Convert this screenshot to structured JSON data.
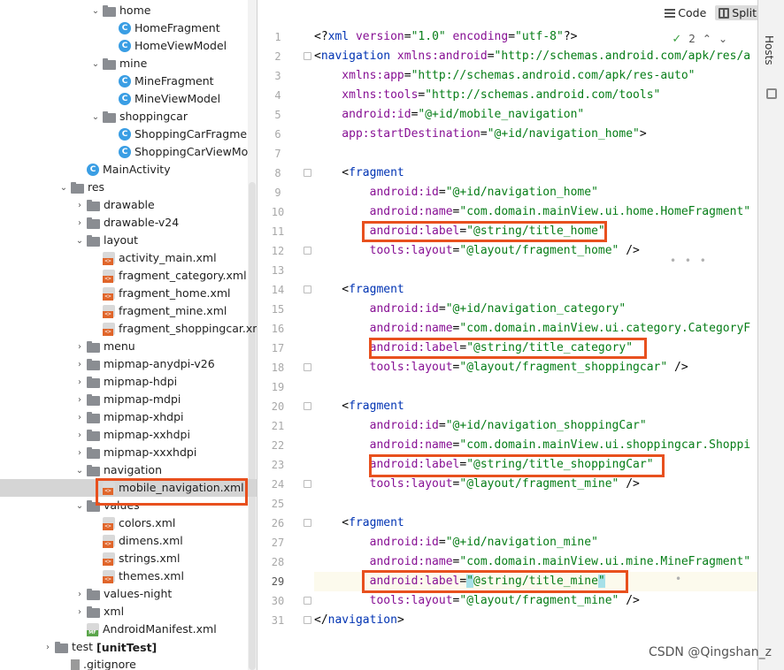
{
  "project_tree": {
    "rows": [
      {
        "label": "home",
        "kind": "folder",
        "depth": 3,
        "expanded": true
      },
      {
        "label": "HomeFragment",
        "kind": "class",
        "depth": 4
      },
      {
        "label": "HomeViewModel",
        "kind": "class",
        "depth": 4
      },
      {
        "label": "mine",
        "kind": "folder",
        "depth": 3,
        "expanded": true
      },
      {
        "label": "MineFragment",
        "kind": "class",
        "depth": 4
      },
      {
        "label": "MineViewModel",
        "kind": "class",
        "depth": 4
      },
      {
        "label": "shoppingcar",
        "kind": "folder",
        "depth": 3,
        "expanded": true
      },
      {
        "label": "ShoppingCarFragme",
        "kind": "class",
        "depth": 4
      },
      {
        "label": "ShoppingCarViewMo",
        "kind": "class",
        "depth": 4
      },
      {
        "label": "MainActivity",
        "kind": "class",
        "depth": 2
      },
      {
        "label": "res",
        "kind": "folder",
        "depth": 1,
        "expanded": true
      },
      {
        "label": "drawable",
        "kind": "folder",
        "depth": 2,
        "expanded": false
      },
      {
        "label": "drawable-v24",
        "kind": "folder",
        "depth": 2,
        "expanded": false
      },
      {
        "label": "layout",
        "kind": "folder",
        "depth": 2,
        "expanded": true
      },
      {
        "label": "activity_main.xml",
        "kind": "xml",
        "depth": 3
      },
      {
        "label": "fragment_category.xml",
        "kind": "xml",
        "depth": 3
      },
      {
        "label": "fragment_home.xml",
        "kind": "xml",
        "depth": 3
      },
      {
        "label": "fragment_mine.xml",
        "kind": "xml",
        "depth": 3
      },
      {
        "label": "fragment_shoppingcar.xml",
        "kind": "xml",
        "depth": 3
      },
      {
        "label": "menu",
        "kind": "folder",
        "depth": 2,
        "expanded": false
      },
      {
        "label": "mipmap-anydpi-v26",
        "kind": "folder",
        "depth": 2,
        "expanded": false
      },
      {
        "label": "mipmap-hdpi",
        "kind": "folder",
        "depth": 2,
        "expanded": false
      },
      {
        "label": "mipmap-mdpi",
        "kind": "folder",
        "depth": 2,
        "expanded": false
      },
      {
        "label": "mipmap-xhdpi",
        "kind": "folder",
        "depth": 2,
        "expanded": false
      },
      {
        "label": "mipmap-xxhdpi",
        "kind": "folder",
        "depth": 2,
        "expanded": false
      },
      {
        "label": "mipmap-xxxhdpi",
        "kind": "folder",
        "depth": 2,
        "expanded": false
      },
      {
        "label": "navigation",
        "kind": "folder",
        "depth": 2,
        "expanded": true
      },
      {
        "label": "mobile_navigation.xml",
        "kind": "xml",
        "depth": 3,
        "selected": true
      },
      {
        "label": "values",
        "kind": "folder",
        "depth": 2,
        "expanded": true
      },
      {
        "label": "colors.xml",
        "kind": "xml",
        "depth": 3
      },
      {
        "label": "dimens.xml",
        "kind": "xml",
        "depth": 3
      },
      {
        "label": "strings.xml",
        "kind": "xml",
        "depth": 3
      },
      {
        "label": "themes.xml",
        "kind": "xml",
        "depth": 3
      },
      {
        "label": "values-night",
        "kind": "folder",
        "depth": 2,
        "expanded": false
      },
      {
        "label": "xml",
        "kind": "folder",
        "depth": 2,
        "expanded": false
      },
      {
        "label": "AndroidManifest.xml",
        "kind": "manifest",
        "depth": 2
      },
      {
        "label": "test",
        "bold_suffix": "[unitTest]",
        "kind": "folder",
        "depth": 0,
        "expanded": false
      },
      {
        "label": ".gitignore",
        "kind": "file",
        "depth": 1
      }
    ]
  },
  "editor": {
    "toolbar": {
      "code_label": "Code",
      "split_label": "Split"
    },
    "inspection_count": "2",
    "current_line": 29,
    "lines": [
      {
        "n": 1,
        "fold": false,
        "tokens": [
          [
            "punct",
            "<?"
          ],
          [
            "tag",
            "xml"
          ],
          [
            "attr",
            " version"
          ],
          [
            "punct",
            "="
          ],
          [
            "str",
            "\"1.0\""
          ],
          [
            "attr",
            " encoding"
          ],
          [
            "punct",
            "="
          ],
          [
            "str",
            "\"utf-8\""
          ],
          [
            "punct",
            "?>"
          ]
        ]
      },
      {
        "n": 2,
        "fold": true,
        "tokens": [
          [
            "punct",
            "<"
          ],
          [
            "tag",
            "navigation"
          ],
          [
            "attr",
            " xmlns:android"
          ],
          [
            "punct",
            "="
          ],
          [
            "str",
            "\"http://schemas.android.com/apk/res/a"
          ]
        ]
      },
      {
        "n": 3,
        "fold": false,
        "tokens": [
          [
            "attr",
            "    xmlns:app"
          ],
          [
            "punct",
            "="
          ],
          [
            "str",
            "\"http://schemas.android.com/apk/res-auto\""
          ]
        ]
      },
      {
        "n": 4,
        "fold": false,
        "tokens": [
          [
            "attr",
            "    xmlns:tools"
          ],
          [
            "punct",
            "="
          ],
          [
            "str",
            "\"http://schemas.android.com/tools\""
          ]
        ]
      },
      {
        "n": 5,
        "fold": false,
        "tokens": [
          [
            "attr",
            "    android:id"
          ],
          [
            "punct",
            "="
          ],
          [
            "str",
            "\"@+id/mobile_navigation\""
          ]
        ]
      },
      {
        "n": 6,
        "fold": false,
        "tokens": [
          [
            "attr",
            "    app:startDestination"
          ],
          [
            "punct",
            "="
          ],
          [
            "str",
            "\"@+id/navigation_home\""
          ],
          [
            "punct",
            ">"
          ]
        ]
      },
      {
        "n": 7,
        "fold": false,
        "tokens": []
      },
      {
        "n": 8,
        "fold": true,
        "tokens": [
          [
            "punct",
            "    <"
          ],
          [
            "tag",
            "fragment"
          ]
        ]
      },
      {
        "n": 9,
        "fold": false,
        "tokens": [
          [
            "attr",
            "        android:id"
          ],
          [
            "punct",
            "="
          ],
          [
            "str",
            "\"@+id/navigation_home\""
          ]
        ]
      },
      {
        "n": 10,
        "fold": false,
        "tokens": [
          [
            "attr",
            "        android:name"
          ],
          [
            "punct",
            "="
          ],
          [
            "str",
            "\"com.domain.mainView.ui.home.HomeFragment\""
          ]
        ]
      },
      {
        "n": 11,
        "fold": false,
        "tokens": [
          [
            "attr",
            "        android:label"
          ],
          [
            "punct",
            "="
          ],
          [
            "str",
            "\"@string/title_home\""
          ]
        ]
      },
      {
        "n": 12,
        "fold": true,
        "tokens": [
          [
            "attr",
            "        tools:layout"
          ],
          [
            "punct",
            "="
          ],
          [
            "str",
            "\"@layout/fragment_home\""
          ],
          [
            "punct",
            " />"
          ]
        ]
      },
      {
        "n": 13,
        "fold": false,
        "tokens": []
      },
      {
        "n": 14,
        "fold": true,
        "tokens": [
          [
            "punct",
            "    <"
          ],
          [
            "tag",
            "fragment"
          ]
        ]
      },
      {
        "n": 15,
        "fold": false,
        "tokens": [
          [
            "attr",
            "        android:id"
          ],
          [
            "punct",
            "="
          ],
          [
            "str",
            "\"@+id/navigation_category\""
          ]
        ]
      },
      {
        "n": 16,
        "fold": false,
        "tokens": [
          [
            "attr",
            "        android:name"
          ],
          [
            "punct",
            "="
          ],
          [
            "str",
            "\"com.domain.mainView.ui.category.CategoryF"
          ]
        ]
      },
      {
        "n": 17,
        "fold": false,
        "tokens": [
          [
            "attr",
            "        android:label"
          ],
          [
            "punct",
            "="
          ],
          [
            "str",
            "\"@string/title_category\""
          ]
        ]
      },
      {
        "n": 18,
        "fold": true,
        "tokens": [
          [
            "attr",
            "        tools:layout"
          ],
          [
            "punct",
            "="
          ],
          [
            "str",
            "\"@layout/fragment_shoppingcar\""
          ],
          [
            "punct",
            " />"
          ]
        ]
      },
      {
        "n": 19,
        "fold": false,
        "tokens": []
      },
      {
        "n": 20,
        "fold": true,
        "tokens": [
          [
            "punct",
            "    <"
          ],
          [
            "tag",
            "fragment"
          ]
        ]
      },
      {
        "n": 21,
        "fold": false,
        "tokens": [
          [
            "attr",
            "        android:id"
          ],
          [
            "punct",
            "="
          ],
          [
            "str",
            "\"@+id/navigation_shoppingCar\""
          ]
        ]
      },
      {
        "n": 22,
        "fold": false,
        "tokens": [
          [
            "attr",
            "        android:name"
          ],
          [
            "punct",
            "="
          ],
          [
            "str",
            "\"com.domain.mainView.ui.shoppingcar.Shoppi"
          ]
        ]
      },
      {
        "n": 23,
        "fold": false,
        "tokens": [
          [
            "attr",
            "        android:label"
          ],
          [
            "punct",
            "="
          ],
          [
            "str",
            "\"@string/title_shoppingCar\""
          ]
        ]
      },
      {
        "n": 24,
        "fold": true,
        "tokens": [
          [
            "attr",
            "        tools:layout"
          ],
          [
            "punct",
            "="
          ],
          [
            "str",
            "\"@layout/fragment_mine\""
          ],
          [
            "punct",
            " />"
          ]
        ]
      },
      {
        "n": 25,
        "fold": false,
        "tokens": []
      },
      {
        "n": 26,
        "fold": true,
        "tokens": [
          [
            "punct",
            "    <"
          ],
          [
            "tag",
            "fragment"
          ]
        ]
      },
      {
        "n": 27,
        "fold": false,
        "tokens": [
          [
            "attr",
            "        android:id"
          ],
          [
            "punct",
            "="
          ],
          [
            "str",
            "\"@+id/navigation_mine\""
          ]
        ]
      },
      {
        "n": 28,
        "fold": false,
        "tokens": [
          [
            "attr",
            "        android:name"
          ],
          [
            "punct",
            "="
          ],
          [
            "str",
            "\"com.domain.mainView.ui.mine.MineFragment\""
          ]
        ]
      },
      {
        "n": 29,
        "fold": false,
        "tokens": [
          [
            "attr",
            "        android:label"
          ],
          [
            "punct",
            "="
          ],
          [
            "caret",
            "\""
          ],
          [
            "str",
            "@string/title_mine"
          ],
          [
            "caret",
            "\""
          ]
        ]
      },
      {
        "n": 30,
        "fold": true,
        "tokens": [
          [
            "attr",
            "        tools:layout"
          ],
          [
            "punct",
            "="
          ],
          [
            "str",
            "\"@layout/fragment_mine\""
          ],
          [
            "punct",
            " />"
          ]
        ]
      },
      {
        "n": 31,
        "fold": true,
        "tokens": [
          [
            "punct",
            "</"
          ],
          [
            "tag",
            "navigation"
          ],
          [
            "punct",
            ">"
          ]
        ]
      }
    ]
  },
  "tool_window": {
    "hosts_label": "Hosts"
  },
  "watermark": "CSDN @Qingshan_z",
  "colors": {
    "highlight_box": "#e8501e",
    "tag": "#0033b3",
    "attribute": "#871094",
    "string": "#067d17"
  }
}
